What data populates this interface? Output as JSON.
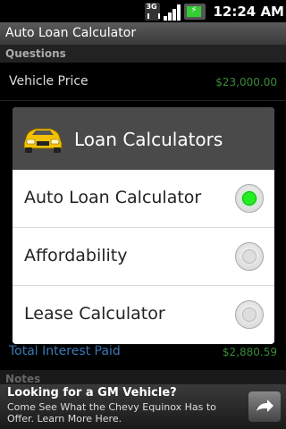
{
  "status_bar": {
    "network": "3G",
    "time": "12:24 AM"
  },
  "app": {
    "title": "Auto Loan Calculator"
  },
  "background": {
    "questions_header": "Questions",
    "vehicle_price_label": "Vehicle Price",
    "vehicle_price_value": "$23,000.00",
    "total_interest_label": "Total Interest Paid",
    "total_interest_value": "$2,880.59",
    "notes_header": "Notes"
  },
  "dialog": {
    "title": "Loan Calculators",
    "icon": "car-icon",
    "options": [
      {
        "label": "Auto Loan Calculator",
        "selected": true
      },
      {
        "label": "Affordability",
        "selected": false
      },
      {
        "label": "Lease Calculator",
        "selected": false
      }
    ]
  },
  "ad": {
    "title": "Looking for a GM Vehicle?",
    "body": "Come See What the Chevy Equinox Has to Offer. Learn More Here.",
    "button_icon": "arrow-forward-icon"
  },
  "colors": {
    "radio_selected": "#22ee22",
    "value_text": "#3a8a3a",
    "dialog_header": "#4a4a4a"
  }
}
